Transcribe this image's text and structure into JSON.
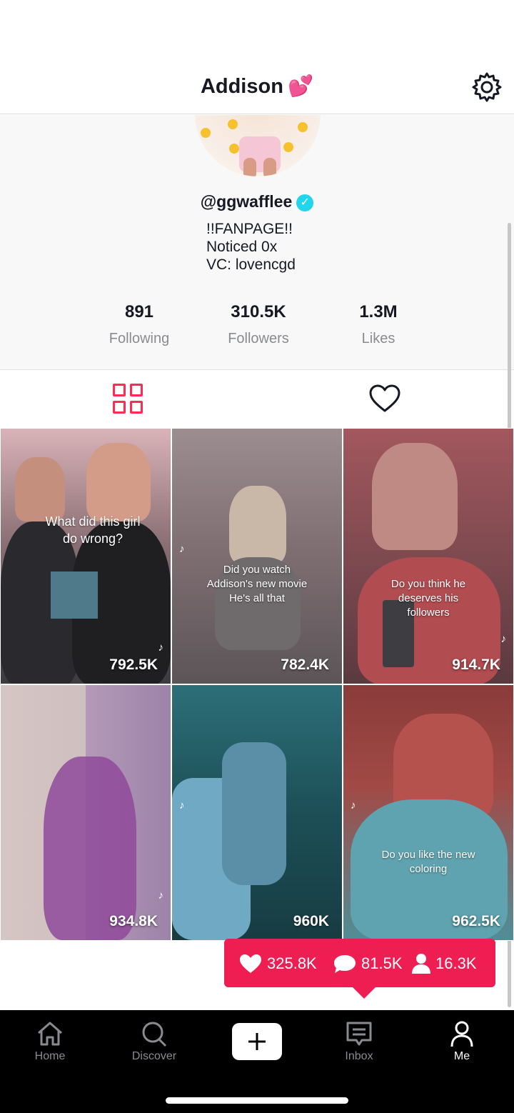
{
  "header": {
    "title": "Addison",
    "title_emoji": "💕",
    "settings_icon": "gear-icon"
  },
  "profile": {
    "username": "@ggwafflee",
    "verified": true,
    "bio": [
      "!!FANPAGE!!",
      "Noticed 0x",
      "VC: lovencgd"
    ],
    "stats": [
      {
        "value": "891",
        "label": "Following"
      },
      {
        "value": "310.5K",
        "label": "Followers"
      },
      {
        "value": "1.3M",
        "label": "Likes"
      }
    ]
  },
  "tabs": {
    "videos_icon": "grid-icon",
    "liked_icon": "heart-outline-icon",
    "active": "videos"
  },
  "videos": [
    {
      "views": "792.5K",
      "caption": "What did this girl do wrong?"
    },
    {
      "views": "782.4K",
      "caption": "Did you watch Addison's new movie He's all that"
    },
    {
      "views": "914.7K",
      "caption": "Do you think he deserves his followers"
    },
    {
      "views": "934.8K",
      "caption": ""
    },
    {
      "views": "960K",
      "caption": ""
    },
    {
      "views": "962.5K",
      "caption": "Do you like the new coloring"
    }
  ],
  "notification": {
    "likes": "325.8K",
    "comments": "81.5K",
    "followers": "16.3K",
    "color": "#ee1d52"
  },
  "bottom_nav": {
    "items": [
      {
        "label": "Home",
        "icon": "home-icon"
      },
      {
        "label": "Discover",
        "icon": "search-icon"
      },
      {
        "label": "",
        "icon": "plus-icon"
      },
      {
        "label": "Inbox",
        "icon": "inbox-icon"
      },
      {
        "label": "Me",
        "icon": "person-icon"
      }
    ],
    "active": "Me"
  }
}
